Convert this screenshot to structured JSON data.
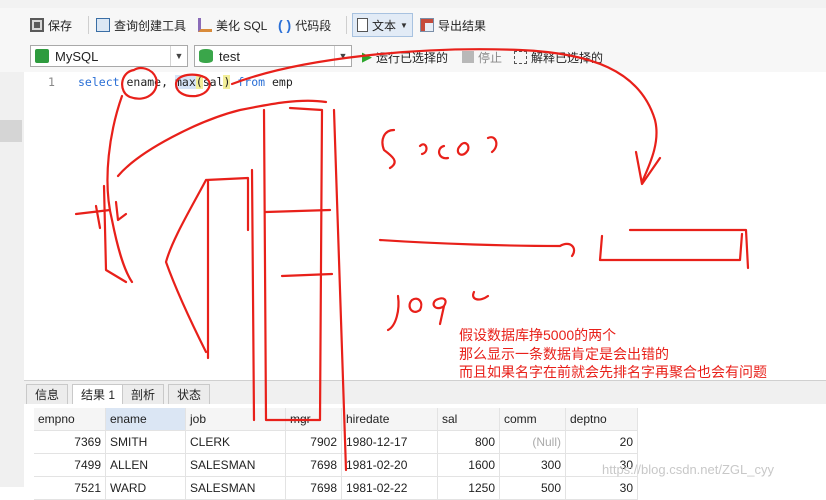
{
  "toolbar": {
    "save": "保存",
    "query_builder": "查询创建工具",
    "beautify_sql": "美化 SQL",
    "code_snippet": "代码段",
    "text_mode": "文本",
    "export": "导出结果"
  },
  "connection": {
    "type": "MySQL",
    "database": "test",
    "run_selected": "运行已选择的",
    "stop": "停止",
    "explain_selected": "解释已选择的"
  },
  "editor": {
    "line_number": "1",
    "tokens": {
      "kw_select": "select",
      "col_ename": "ename,",
      "fn_max": "max",
      "paren_open": "(",
      "arg_sal": "sal",
      "paren_close": ")",
      "kw_from": "from",
      "tbl_emp": "emp"
    }
  },
  "result_tabs": [
    "信息",
    "结果 1",
    "剖析",
    "状态"
  ],
  "grid": {
    "columns": [
      "empno",
      "ename",
      "job",
      "mgr",
      "hiredate",
      "sal",
      "comm",
      "deptno"
    ],
    "rows": [
      [
        "7369",
        "SMITH",
        "CLERK",
        "7902",
        "1980-12-17",
        "800",
        "(Null)",
        "20"
      ],
      [
        "7499",
        "ALLEN",
        "SALESMAN",
        "7698",
        "1981-02-20",
        "1600",
        "300",
        "30"
      ],
      [
        "7521",
        "WARD",
        "SALESMAN",
        "7698",
        "1981-02-22",
        "1250",
        "500",
        "30"
      ]
    ]
  },
  "annotation": {
    "line1": "假设数据库挣5000的两个",
    "line2": "那么显示一条数据肯定是会出错的",
    "line3": "而且如果名字在前就会先排名字再聚合也会有问题"
  },
  "watermark": "https://blog.csdn.net/ZGL_cyy",
  "colors": {
    "annotation": "#e8201a",
    "keyword": "#2a6fd6",
    "run_icon": "#2aa52a"
  }
}
